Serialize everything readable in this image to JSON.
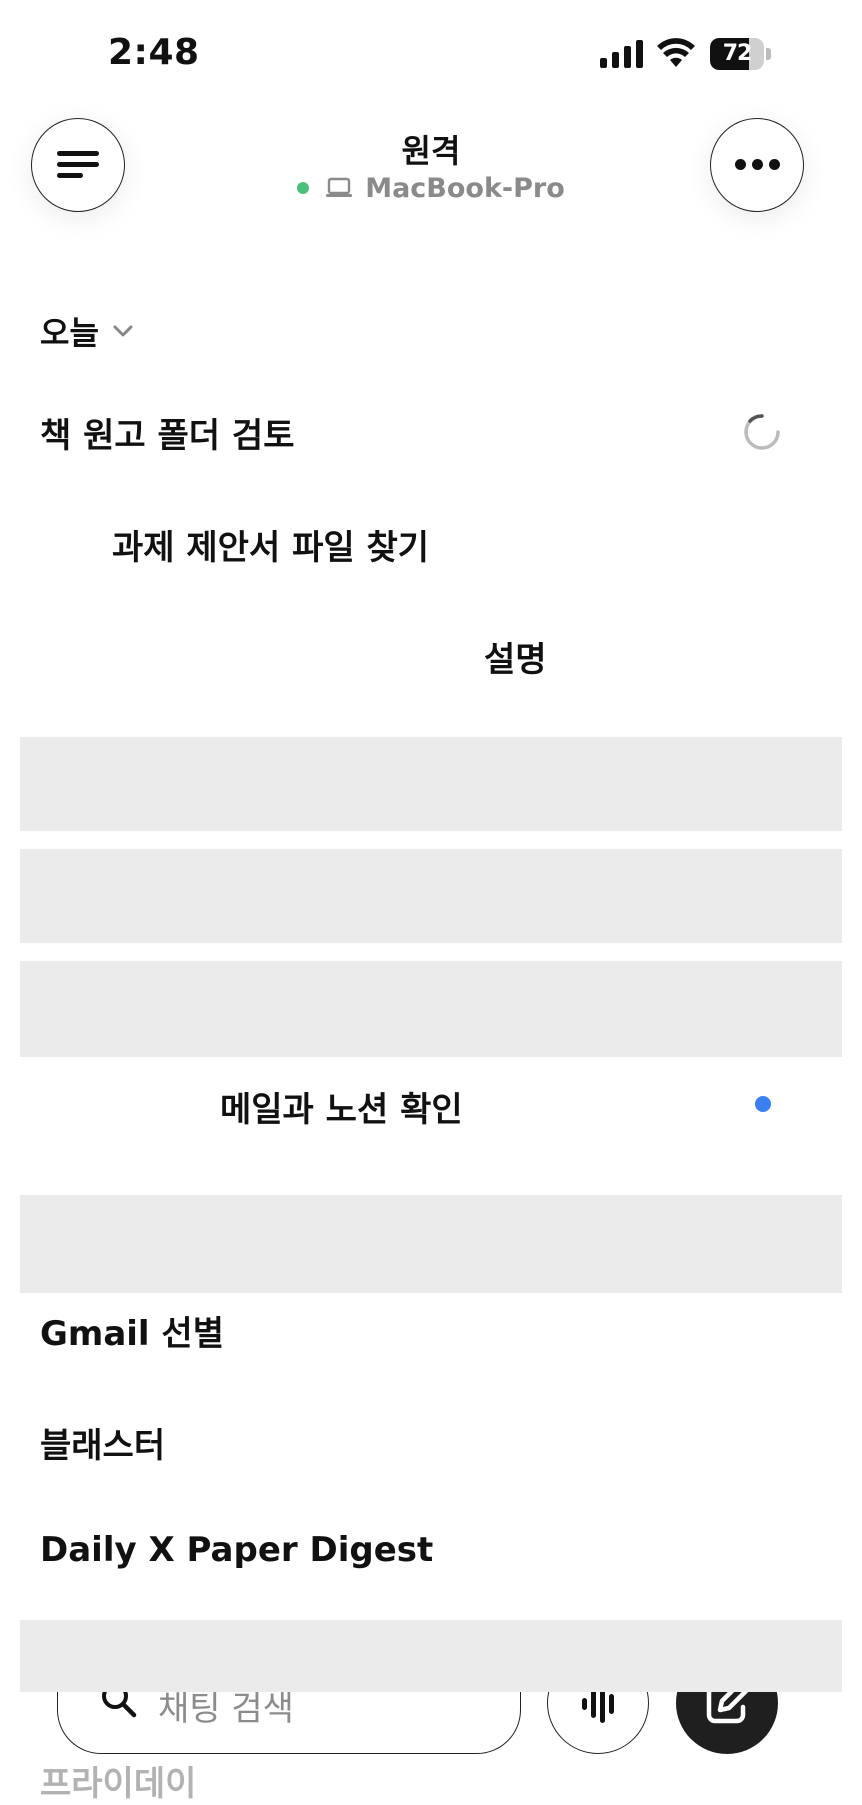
{
  "status_bar": {
    "time": "2:48",
    "battery_level": "72",
    "battery_fraction": 0.72
  },
  "header": {
    "title": "원격",
    "device_name": "MacBook-Pro",
    "status_color": "#4cc07a",
    "menu_icon": "menu-icon",
    "more_icon": "more-horizontal-icon"
  },
  "section": {
    "title": "오늘"
  },
  "items": [
    "책 원고 폴더 검토",
    "과제 제안서 파일 찾기",
    "설명",
    "메일과 노션 확인",
    "Gmail 선별",
    "블래스터",
    "Daily X Paper Digest",
    "프라이데이"
  ],
  "indicators": {
    "unread_color": "#3a7ff0"
  },
  "search": {
    "placeholder": "채팅 검색"
  },
  "bottom": {
    "voice_icon": "voice-waveform-icon",
    "compose_icon": "compose-icon"
  }
}
